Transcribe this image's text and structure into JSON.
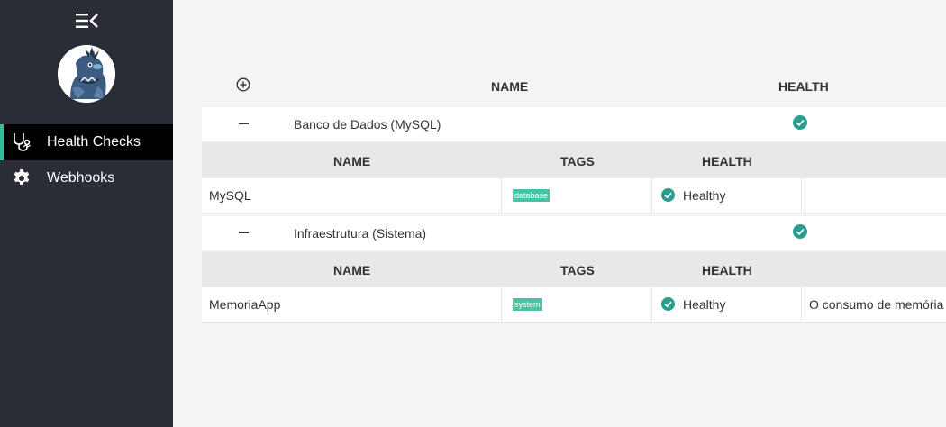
{
  "sidebar": {
    "items": [
      {
        "label": "Health Checks",
        "icon": "stethoscope-icon",
        "active": true
      },
      {
        "label": "Webhooks",
        "icon": "gear-icon",
        "active": false
      }
    ]
  },
  "table": {
    "headers": {
      "name": "NAME",
      "health": "HEALTH"
    },
    "sub_headers": {
      "name": "NAME",
      "tags": "TAGS",
      "health": "HEALTH"
    },
    "groups": [
      {
        "name": "Banco de Dados (MySQL)",
        "status": "healthy",
        "entries": [
          {
            "name": "MySQL",
            "tag": "database",
            "health": "Healthy",
            "description": ""
          }
        ]
      },
      {
        "name": "Infraestrutura (Sistema)",
        "status": "healthy",
        "entries": [
          {
            "name": "MemoriaApp",
            "tag": "system",
            "health": "Healthy",
            "description": "O consumo de memória"
          }
        ]
      }
    ]
  },
  "colors": {
    "sidebar_bg": "#2b2d36",
    "accent": "#2ebf9a",
    "healthy": "#2a9d8f",
    "tag_bg": "#48c2a3"
  }
}
